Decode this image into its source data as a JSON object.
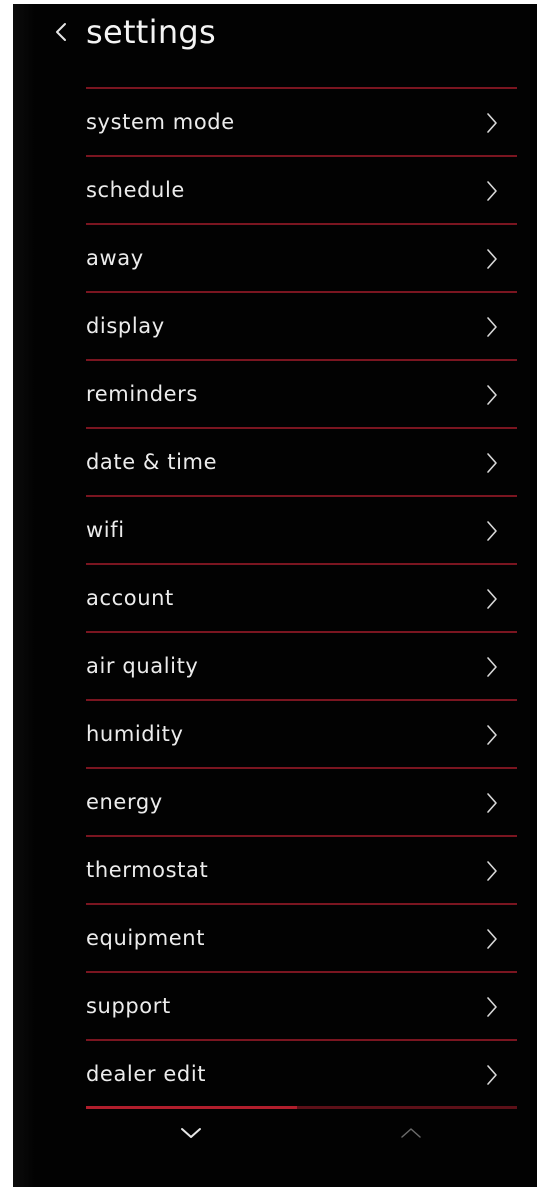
{
  "header": {
    "title": "settings",
    "back_icon": "chevron-left-icon"
  },
  "menu": {
    "items": [
      {
        "label": "system mode"
      },
      {
        "label": "schedule"
      },
      {
        "label": "away"
      },
      {
        "label": "display"
      },
      {
        "label": "reminders"
      },
      {
        "label": "date & time"
      },
      {
        "label": "wifi"
      },
      {
        "label": "account"
      },
      {
        "label": "air quality"
      },
      {
        "label": "humidity"
      },
      {
        "label": "energy"
      },
      {
        "label": "thermostat"
      },
      {
        "label": "equipment"
      },
      {
        "label": "support"
      },
      {
        "label": "dealer edit"
      }
    ],
    "item_icon": "chevron-right-icon"
  },
  "scroll": {
    "position_fraction": 0.49,
    "down_icon": "chevron-down-icon",
    "up_icon": "chevron-up-icon",
    "up_enabled": false
  },
  "colors": {
    "background": "#020202",
    "text": "#ececec",
    "divider": "#7a1520",
    "scroll_track": "#5c1018",
    "scroll_thumb": "#b01e2c",
    "disabled_icon": "#6b6b6b"
  }
}
